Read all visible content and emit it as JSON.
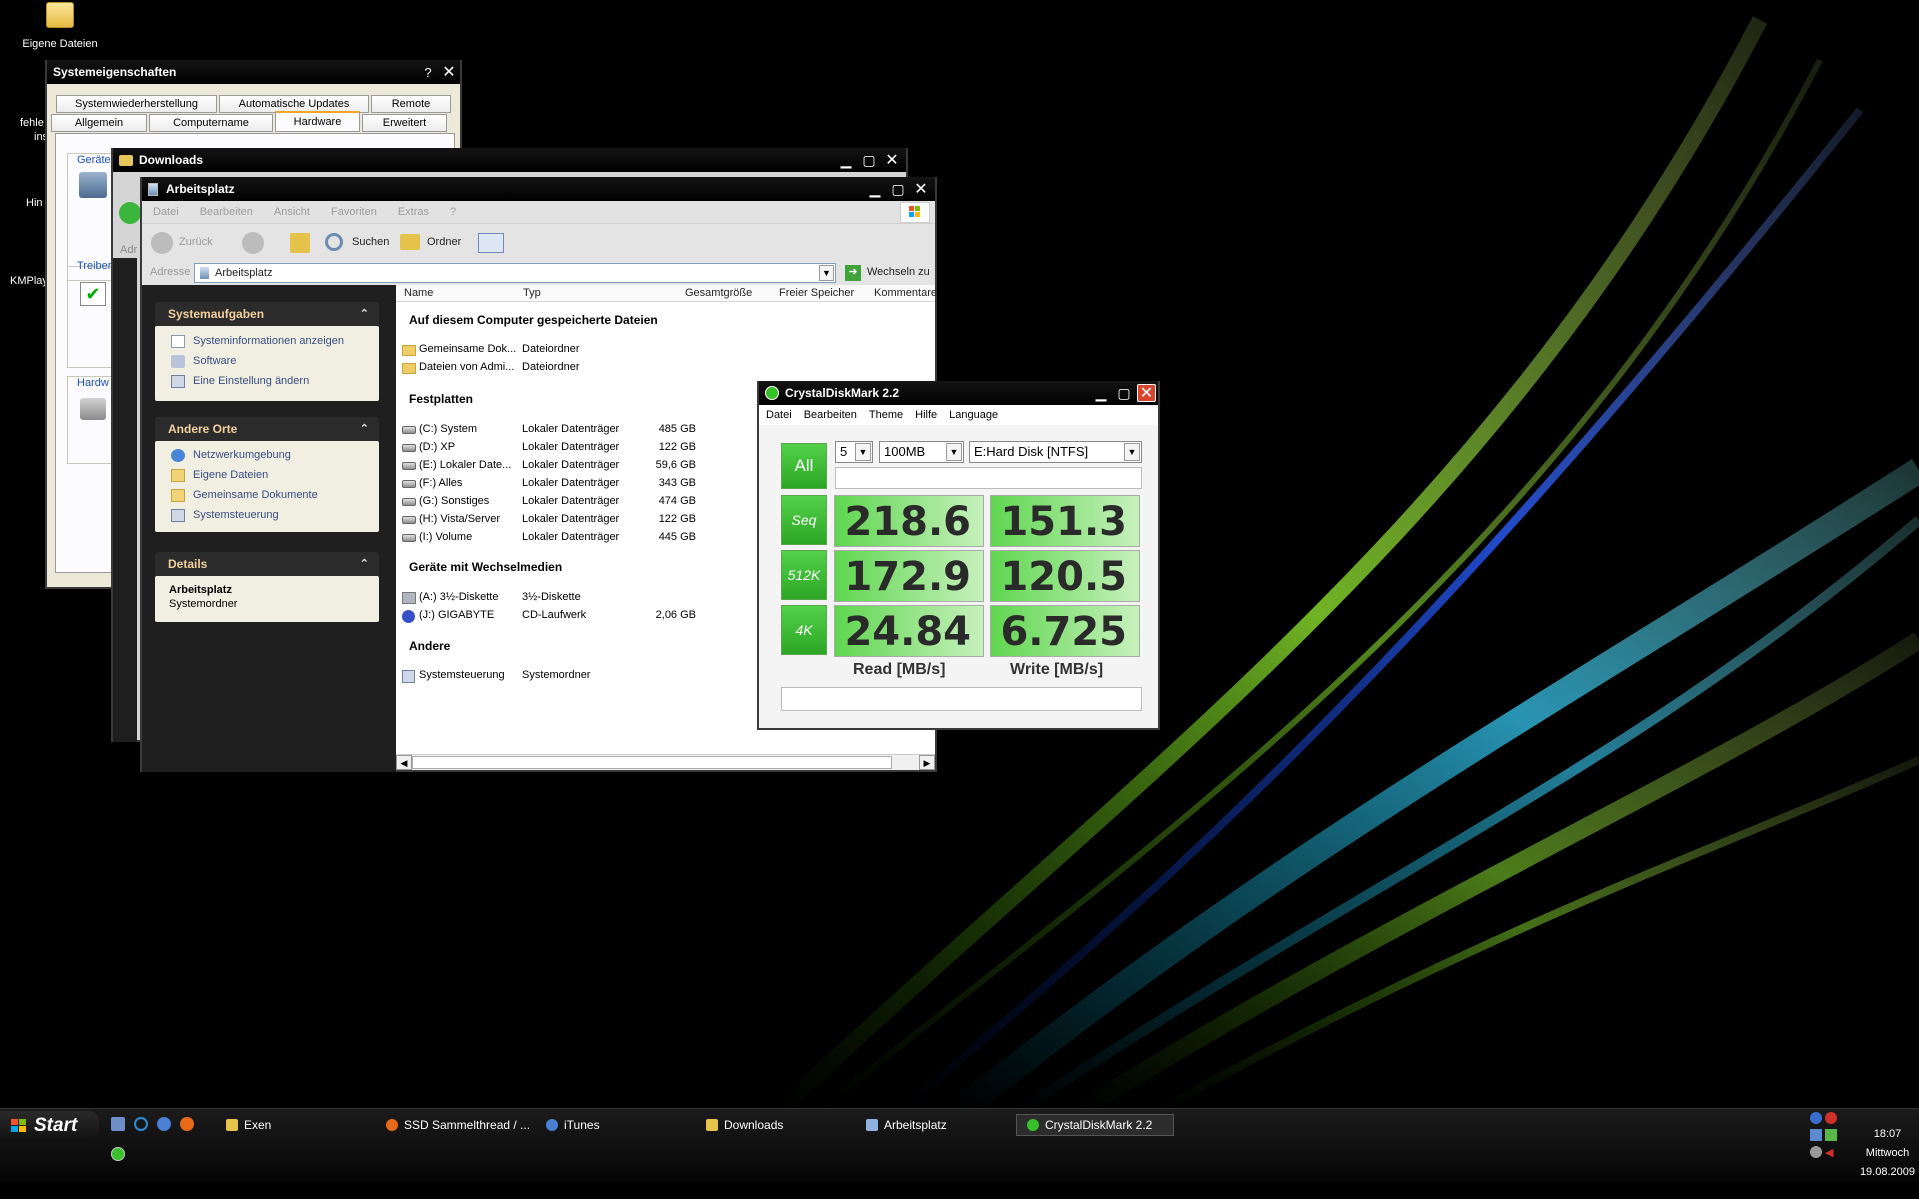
{
  "desktop": {
    "icons": [
      {
        "label": "Eigene Dateien"
      }
    ],
    "cut_labels": [
      "fehle",
      "ins",
      "Hin",
      "KMPlay"
    ]
  },
  "sysprops": {
    "title": "Systemeigenschaften",
    "tabs_row1": [
      "Systemwiederherstellung",
      "Automatische Updates",
      "Remote"
    ],
    "tabs_row2": [
      "Allgemein",
      "Computername",
      "Hardware",
      "Erweitert"
    ],
    "groups": [
      "Geräte",
      "Treiber",
      "Hardw"
    ]
  },
  "downloads": {
    "title": "Downloads",
    "addr_label": "Adr"
  },
  "explorer": {
    "title": "Arbeitsplatz",
    "menu": [
      "Datei",
      "Bearbeiten",
      "Ansicht",
      "Favoriten",
      "Extras",
      "?"
    ],
    "toolbar": {
      "back": "Zurück",
      "search": "Suchen",
      "folders": "Ordner"
    },
    "address": {
      "label": "Adresse",
      "value": "Arbeitsplatz",
      "go": "Wechseln zu"
    },
    "side": {
      "system_tasks": {
        "title": "Systemaufgaben",
        "items": [
          "Systeminformationen anzeigen",
          "Software",
          "Eine Einstellung ändern"
        ]
      },
      "other_places": {
        "title": "Andere Orte",
        "items": [
          "Netzwerkumgebung",
          "Eigene Dateien",
          "Gemeinsame Dokumente",
          "Systemsteuerung"
        ]
      },
      "details": {
        "title": "Details",
        "name": "Arbeitsplatz",
        "type": "Systemordner"
      }
    },
    "columns": [
      "Name",
      "Typ",
      "Gesamtgröße",
      "Freier Speicher",
      "Kommentare"
    ],
    "sections": {
      "files": {
        "title": "Auf diesem Computer gespeicherte Dateien",
        "rows": [
          {
            "name": "Gemeinsame Dok...",
            "type": "Dateiordner",
            "size": ""
          },
          {
            "name": "Dateien von Admi...",
            "type": "Dateiordner",
            "size": ""
          }
        ]
      },
      "drives": {
        "title": "Festplatten",
        "rows": [
          {
            "name": "(C:) System",
            "type": "Lokaler Datenträger",
            "size": "485 GB"
          },
          {
            "name": "(D:) XP",
            "type": "Lokaler Datenträger",
            "size": "122 GB"
          },
          {
            "name": "(E:) Lokaler Date...",
            "type": "Lokaler Datenträger",
            "size": "59,6 GB"
          },
          {
            "name": "(F:) Alles",
            "type": "Lokaler Datenträger",
            "size": "343 GB"
          },
          {
            "name": "(G:) Sonstiges",
            "type": "Lokaler Datenträger",
            "size": "474 GB"
          },
          {
            "name": "(H:) Vista/Server",
            "type": "Lokaler Datenträger",
            "size": "122 GB"
          },
          {
            "name": "(I:) Volume",
            "type": "Lokaler Datenträger",
            "size": "445 GB"
          }
        ]
      },
      "removable": {
        "title": "Geräte mit Wechselmedien",
        "rows": [
          {
            "name": "(A:) 3½-Diskette",
            "type": "3½-Diskette",
            "size": ""
          },
          {
            "name": "(J:) GIGABYTE",
            "type": "CD-Laufwerk",
            "size": "2,06 GB"
          }
        ]
      },
      "other": {
        "title": "Andere",
        "rows": [
          {
            "name": "Systemsteuerung",
            "type": "Systemordner",
            "size": ""
          }
        ]
      }
    }
  },
  "cdm": {
    "title": "CrystalDiskMark 2.2",
    "menu": [
      "Datei",
      "Bearbeiten",
      "Theme",
      "Hilfe",
      "Language"
    ],
    "all_label": "All",
    "count": "5",
    "size": "100MB",
    "drive": "E:Hard Disk [NTFS]",
    "rows": [
      {
        "label": "Seq",
        "read": "218.6",
        "write": "151.3"
      },
      {
        "label": "512K",
        "read": "172.9",
        "write": "120.5"
      },
      {
        "label": "4K",
        "read": "24.84",
        "write": "6.725"
      }
    ],
    "read_label": "Read [MB/s]",
    "write_label": "Write [MB/s]"
  },
  "taskbar": {
    "start": "Start",
    "items": [
      "Exen",
      "SSD Sammelthread / ...",
      "iTunes",
      "Downloads",
      "Arbeitsplatz",
      "CrystalDiskMark 2.2"
    ],
    "clock": {
      "time": "18:07",
      "day": "Mittwoch",
      "date": "19.08.2009"
    }
  },
  "colors": {
    "accent_green": "#3cc63a",
    "title_bar": "#000000",
    "close_red": "#d9452f"
  }
}
